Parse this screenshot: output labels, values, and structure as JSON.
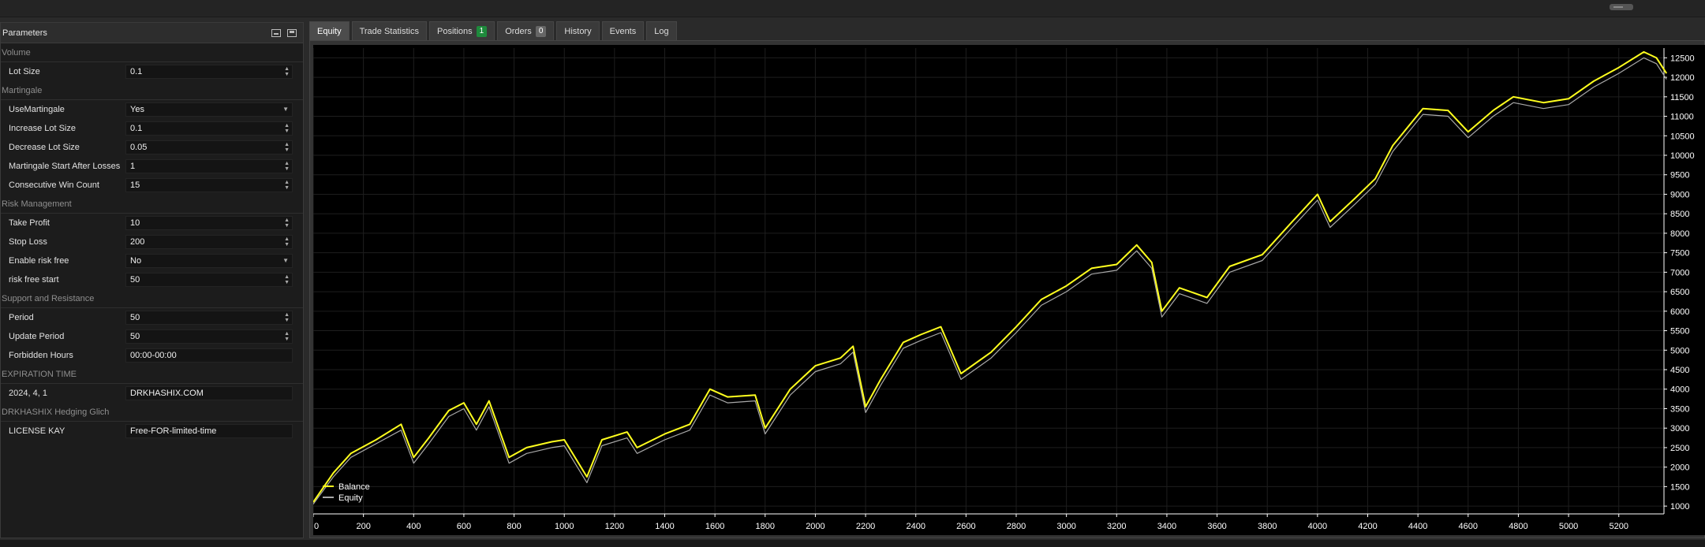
{
  "params": {
    "title": "Parameters",
    "sections": [
      {
        "label": "Volume",
        "rows": [
          {
            "label": "Lot Size",
            "value": "0.1",
            "control": "spin"
          }
        ]
      },
      {
        "label": "Martingale",
        "rows": [
          {
            "label": "UseMartingale",
            "value": "Yes",
            "control": "select"
          },
          {
            "label": "Increase Lot Size",
            "value": "0.1",
            "control": "spin"
          },
          {
            "label": "Decrease Lot Size",
            "value": "0.05",
            "control": "spin"
          },
          {
            "label": "Martingale Start After Losses",
            "value": "1",
            "control": "spin"
          },
          {
            "label": "Consecutive Win Count",
            "value": "15",
            "control": "spin"
          }
        ]
      },
      {
        "label": "Risk Management",
        "rows": [
          {
            "label": "Take Profit",
            "value": "10",
            "control": "spin"
          },
          {
            "label": "Stop Loss",
            "value": "200",
            "control": "spin"
          },
          {
            "label": "Enable risk free",
            "value": "No",
            "control": "select"
          },
          {
            "label": "risk free start",
            "value": "50",
            "control": "spin"
          }
        ]
      },
      {
        "label": "Support and Resistance",
        "rows": [
          {
            "label": "Period",
            "value": "50",
            "control": "spin"
          },
          {
            "label": "Update Period",
            "value": "50",
            "control": "spin"
          },
          {
            "label": "Forbidden Hours",
            "value": "00:00-00:00",
            "control": "text"
          }
        ]
      },
      {
        "label": "EXPIRATION TIME",
        "rows": [
          {
            "label": "2024, 4, 1",
            "value": "DRKHASHIX.COM",
            "control": "text"
          }
        ]
      },
      {
        "label": "DRKHASHIX Hedging Glich",
        "rows": [
          {
            "label": "LICENSE KAY",
            "value": "Free-FOR-limited-time",
            "control": "text"
          }
        ]
      }
    ]
  },
  "tabs": [
    {
      "label": "Equity",
      "active": true
    },
    {
      "label": "Trade Statistics"
    },
    {
      "label": "Positions",
      "badge": "1",
      "badge_color": "green"
    },
    {
      "label": "Orders",
      "badge": "0",
      "badge_color": "gray"
    },
    {
      "label": "History"
    },
    {
      "label": "Events"
    },
    {
      "label": "Log"
    }
  ],
  "colors": {
    "balance": "#ffff1e",
    "equity": "#a8a8a8",
    "background": "#000000",
    "grid": "#1e1e1e",
    "axis_text": "#ffffff"
  },
  "chart_data": {
    "type": "line",
    "legend_position": "bottom-left",
    "grid": true,
    "xlim": [
      0,
      5380
    ],
    "ylim": [
      800,
      12750
    ],
    "x_ticks": [
      0,
      200,
      400,
      600,
      800,
      1000,
      1200,
      1400,
      1600,
      1800,
      2000,
      2200,
      2400,
      2600,
      2800,
      3000,
      3200,
      3400,
      3600,
      3800,
      4000,
      4200,
      4400,
      4600,
      4800,
      5000,
      5200
    ],
    "y_ticks": [
      1000,
      1500,
      2000,
      2500,
      3000,
      3500,
      4000,
      4500,
      5000,
      5500,
      6000,
      6500,
      7000,
      7500,
      8000,
      8500,
      9000,
      9500,
      10000,
      10500,
      11000,
      11500,
      12000,
      12500
    ],
    "series": [
      {
        "name": "Balance",
        "x": [
          0,
          80,
          150,
          250,
          350,
          400,
          460,
          540,
          600,
          650,
          700,
          780,
          850,
          950,
          1000,
          1090,
          1150,
          1250,
          1290,
          1400,
          1500,
          1580,
          1650,
          1760,
          1800,
          1900,
          2000,
          2100,
          2150,
          2200,
          2260,
          2350,
          2420,
          2500,
          2580,
          2700,
          2800,
          2900,
          3000,
          3100,
          3200,
          3280,
          3340,
          3380,
          3450,
          3560,
          3650,
          3780,
          3900,
          4000,
          4050,
          4150,
          4230,
          4300,
          4420,
          4520,
          4600,
          4700,
          4780,
          4900,
          5000,
          5100,
          5200,
          5300,
          5350,
          5390
        ],
        "y": [
          1100,
          1850,
          2350,
          2700,
          3100,
          2250,
          2750,
          3450,
          3650,
          3100,
          3700,
          2250,
          2500,
          2650,
          2700,
          1750,
          2700,
          2900,
          2500,
          2850,
          3100,
          4000,
          3800,
          3850,
          3000,
          4000,
          4600,
          4800,
          5100,
          3550,
          4250,
          5200,
          5400,
          5600,
          4400,
          4950,
          5600,
          6300,
          6650,
          7100,
          7200,
          7700,
          7250,
          6000,
          6600,
          6350,
          7150,
          7450,
          8300,
          9000,
          8300,
          8900,
          9400,
          10250,
          11200,
          11150,
          10600,
          11150,
          11500,
          11350,
          11450,
          11900,
          12250,
          12650,
          12500,
          12100
        ]
      },
      {
        "name": "Equity",
        "x": [
          0,
          80,
          150,
          250,
          350,
          400,
          460,
          540,
          600,
          650,
          700,
          780,
          850,
          950,
          1000,
          1090,
          1150,
          1250,
          1290,
          1400,
          1500,
          1580,
          1650,
          1760,
          1800,
          1900,
          2000,
          2100,
          2150,
          2200,
          2260,
          2350,
          2420,
          2500,
          2580,
          2700,
          2800,
          2900,
          3000,
          3100,
          3200,
          3280,
          3340,
          3380,
          3450,
          3560,
          3650,
          3780,
          3900,
          4000,
          4050,
          4150,
          4230,
          4300,
          4420,
          4520,
          4600,
          4700,
          4780,
          4900,
          5000,
          5100,
          5200,
          5300,
          5350,
          5390
        ],
        "y": [
          1050,
          1750,
          2250,
          2600,
          2950,
          2100,
          2600,
          3300,
          3500,
          2950,
          3550,
          2100,
          2350,
          2500,
          2550,
          1600,
          2550,
          2750,
          2350,
          2700,
          2950,
          3850,
          3650,
          3700,
          2850,
          3850,
          4450,
          4650,
          4950,
          3400,
          4100,
          5050,
          5250,
          5450,
          4250,
          4800,
          5450,
          6150,
          6500,
          6950,
          7050,
          7550,
          7100,
          5850,
          6450,
          6200,
          7000,
          7300,
          8150,
          8850,
          8150,
          8750,
          9250,
          10100,
          11050,
          11000,
          10450,
          11000,
          11350,
          11200,
          11300,
          11750,
          12100,
          12500,
          12350,
          11950
        ]
      }
    ]
  }
}
